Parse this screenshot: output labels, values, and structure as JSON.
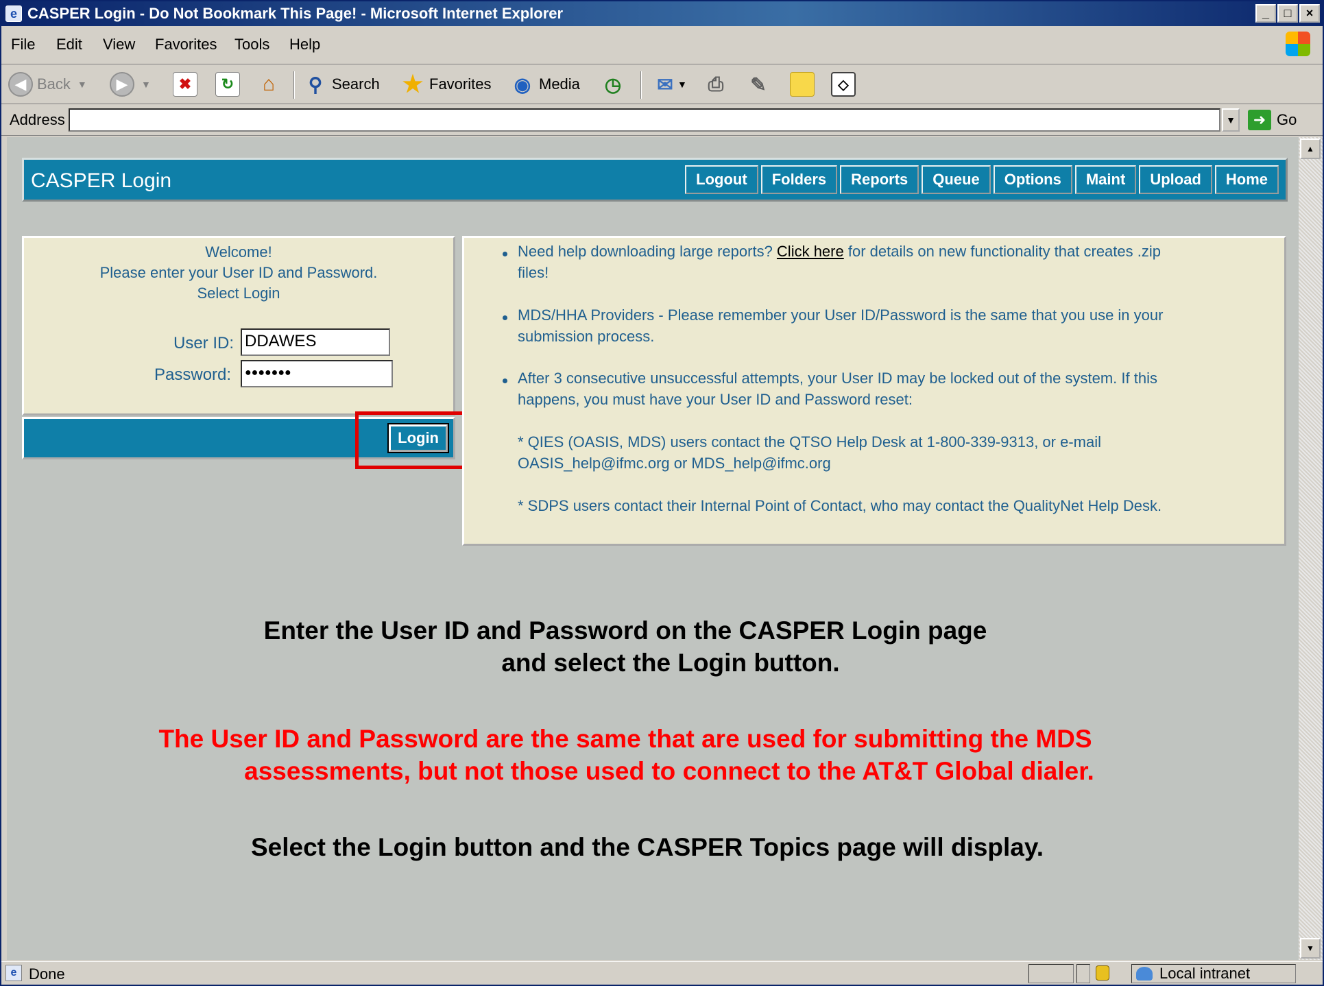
{
  "window": {
    "title": "CASPER Login - Do Not Bookmark This Page! - Microsoft Internet Explorer",
    "controls": [
      "_",
      "□",
      "×"
    ]
  },
  "menubar": {
    "items": [
      "File",
      "Edit",
      "View",
      "Favorites",
      "Tools",
      "Help"
    ]
  },
  "toolbar": {
    "back": "Back",
    "search": "Search",
    "favorites": "Favorites",
    "media": "Media"
  },
  "addressbar": {
    "label": "Address",
    "value": "",
    "go": "Go"
  },
  "page": {
    "header": {
      "title": "CASPER Login",
      "nav": [
        "Logout",
        "Folders",
        "Reports",
        "Queue",
        "Options",
        "Maint",
        "Upload",
        "Home"
      ]
    },
    "login": {
      "welcome": "Welcome!",
      "instruction": "Please enter your User ID and Password.",
      "select": "Select Login",
      "userid_label": "User ID:",
      "userid_value": "DDAWES",
      "password_label": "Password:",
      "password_value": "●●●●●●●",
      "button": "Login"
    },
    "info": {
      "b1_pre": "Need help downloading large reports? ",
      "b1_link": "Click here",
      "b1_post": " for details on new functionality that creates .zip",
      "b1_line2": "files!",
      "b2_line1": "MDS/HHA Providers - Please remember your User ID/Password is the same that you use in your",
      "b2_line2": "submission process.",
      "b3_line1": "After 3 consecutive unsuccessful attempts, your User ID may be locked out of the system. If this",
      "b3_line2": "happens, you must have your User ID and Password reset:",
      "qies_line1": "* QIES (OASIS, MDS) users contact the QTSO Help Desk at 1-800-339-9313, or e-mail",
      "qies_line2": "OASIS_help@ifmc.org or MDS_help@ifmc.org",
      "sdps": "* SDPS users contact their Internal Point of Contact, who may contact the QualityNet Help Desk."
    },
    "instructions": {
      "line1": "Enter the User ID and Password on the CASPER Login page",
      "line2": "and select the Login button.",
      "red1": "The User ID and Password are the same that are used for submitting the MDS",
      "red2": "assessments, but not those used to connect to the AT&T Global dialer.",
      "line3": "Select the Login button and the CASPER Topics page will display."
    }
  },
  "statusbar": {
    "status": "Done",
    "zone": "Local intranet"
  },
  "icons": {
    "app": "ie-page-icon",
    "back": "back-arrow-icon",
    "forward": "forward-arrow-icon",
    "stop": "stop-icon",
    "refresh": "refresh-icon",
    "home": "home-icon",
    "search": "search-icon",
    "favorites": "star-icon",
    "media": "media-icon",
    "history": "history-icon",
    "mail": "mail-icon",
    "print": "print-icon",
    "edit": "edit-icon",
    "discuss": "discuss-icon",
    "messenger": "messenger-icon"
  },
  "colors": {
    "header_bg": "#0f7fa8",
    "panel_bg": "#ece9d0",
    "page_bg": "#c0c4c0",
    "highlight": "#e00000",
    "red_text": "#ff0000"
  }
}
